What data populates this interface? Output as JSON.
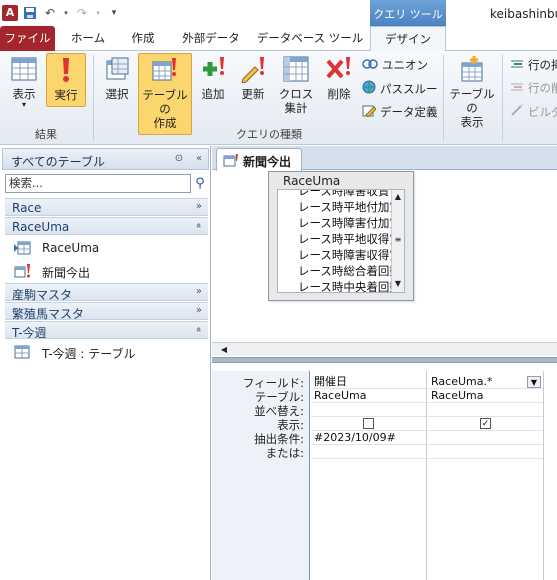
{
  "window": {
    "title": "keibashinbu",
    "context_tab_title": "クエリ ツール"
  },
  "tabs": [
    "ファイル",
    "ホーム",
    "作成",
    "外部データ",
    "データベース ツール",
    "デザイン"
  ],
  "ribbon": {
    "results_group": {
      "label": "結果",
      "view": "表示",
      "run": "実行"
    },
    "query_type_group": {
      "label": "クエリの種類",
      "select": "選択",
      "make_table": "テーブルの作成",
      "make_table_l1": "テーブルの",
      "make_table_l2": "作成",
      "append": "追加",
      "update": "更新",
      "crosstab_l1": "クロス",
      "crosstab_l2": "集計",
      "delete": "削除",
      "union": "ユニオン",
      "passthrough": "パススルー",
      "data_definition": "データ定義"
    },
    "setup_group": {
      "show_table_l1": "テーブルの",
      "show_table_l2": "表示",
      "insert_rows": "行の挿",
      "delete_rows": "行の削",
      "builder": "ビルダ"
    }
  },
  "nav": {
    "title": "すべてのテーブル",
    "search_placeholder": "検索...",
    "sections": [
      {
        "name": "Race",
        "items": []
      },
      {
        "name": "RaceUma",
        "items": [
          "RaceUma",
          "新聞今出"
        ]
      },
      {
        "name": "産駒マスタ",
        "items": []
      },
      {
        "name": "繁殖馬マスタ",
        "items": []
      },
      {
        "name": "T-今週",
        "items": [
          "T-今週 : テーブル"
        ]
      }
    ]
  },
  "document": {
    "tab_title": "新聞今出",
    "field_list": {
      "table_name": "RaceUma",
      "fields": [
        "レース時障害収賞",
        "レース時平地付加賞",
        "レース時障害付加賞",
        "レース時平地収得賞",
        "レース時障害収得賞",
        "レース時総合着回数",
        "レース時中央着回数"
      ]
    },
    "grid": {
      "row_labels": [
        "フィールド:",
        "テーブル:",
        "並べ替え:",
        "表示:",
        "抽出条件:",
        "または:"
      ],
      "columns": [
        {
          "field": "開催日",
          "table": "RaceUma",
          "sort": "",
          "show": false,
          "criteria": "#2023/10/09#",
          "or": ""
        },
        {
          "field": "RaceUma.*",
          "table": "RaceUma",
          "sort": "",
          "show": true,
          "criteria": "",
          "or": ""
        }
      ]
    }
  },
  "colors": {
    "file_tab": "#a4262c",
    "context_tab": "#4a82c2",
    "highlight": "#fbd56e"
  }
}
